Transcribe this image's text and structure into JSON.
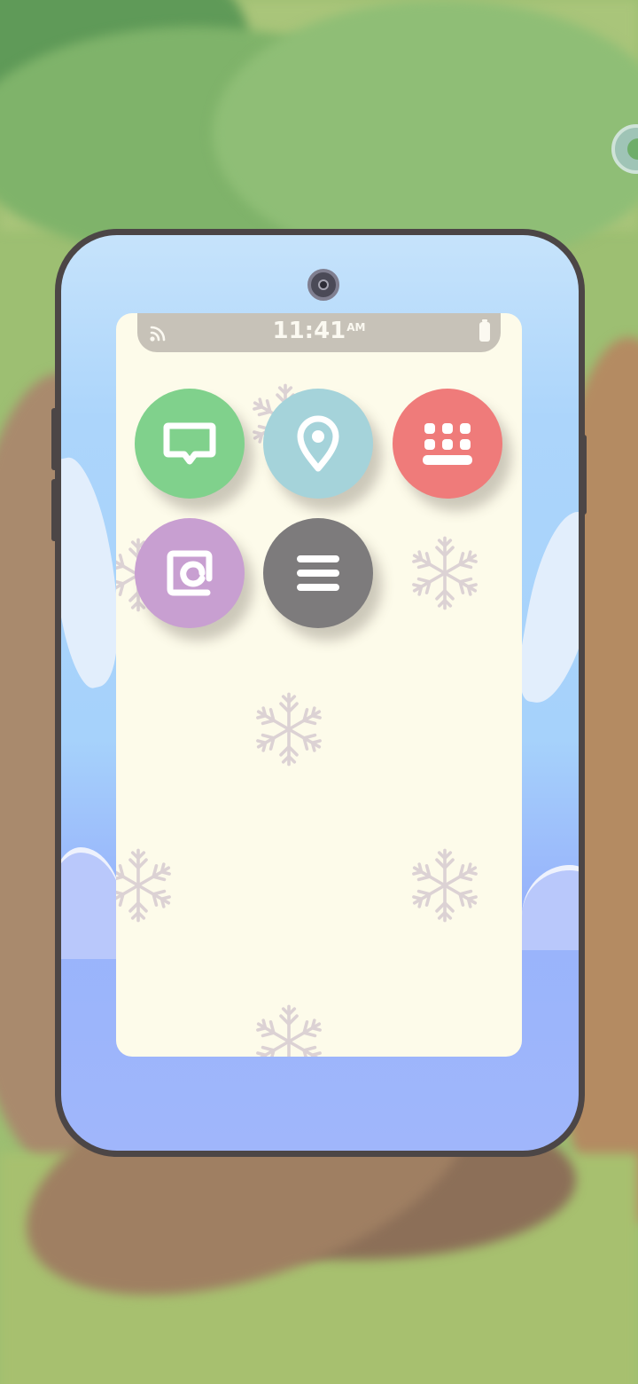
{
  "status_bar": {
    "time": "11:41",
    "ampm": "AM",
    "wifi_icon": "wifi-icon",
    "battery_icon": "battery-icon"
  },
  "apps": [
    {
      "name": "messages",
      "icon": "chat-bubble-icon",
      "color": "#80d18c"
    },
    {
      "name": "map",
      "icon": "location-pin-icon",
      "color": "#a5d3da"
    },
    {
      "name": "keyboard",
      "icon": "keyboard-icon",
      "color": "#ef7b7a"
    },
    {
      "name": "contacts",
      "icon": "at-sign-icon",
      "color": "#c89fd1"
    },
    {
      "name": "menu",
      "icon": "hamburger-menu-icon",
      "color": "#7d7b7c"
    }
  ],
  "colors": {
    "phone_frame": "#4c4646",
    "screen_bg": "#fdfbea",
    "status_bar": "#c7c2b8",
    "snowflake": "#dcd2d4"
  }
}
